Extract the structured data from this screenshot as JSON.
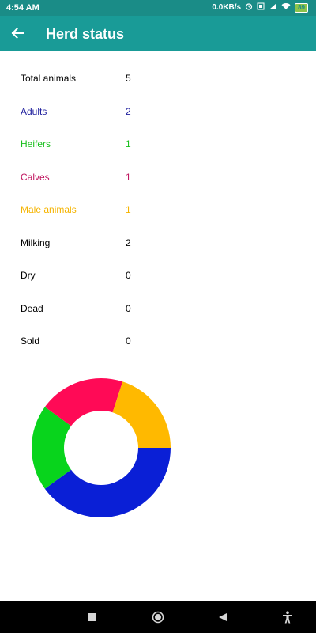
{
  "status_bar": {
    "time": "4:54 AM",
    "net_speed": "0.0KB/s",
    "battery": "89"
  },
  "app_bar": {
    "title": "Herd status",
    "back_icon": "arrow-left-icon"
  },
  "stats": [
    {
      "label": "Total animals",
      "value": "5",
      "color": "#000000"
    },
    {
      "label": "Adults",
      "value": "2",
      "color": "#1c1c9c"
    },
    {
      "label": "Heifers",
      "value": "1",
      "color": "#19c01d"
    },
    {
      "label": "Calves",
      "value": "1",
      "color": "#c0155f"
    },
    {
      "label": "Male animals",
      "value": "1",
      "color": "#f5b400"
    },
    {
      "label": "Milking",
      "value": "2",
      "color": "#000000"
    },
    {
      "label": "Dry",
      "value": "0",
      "color": "#000000"
    },
    {
      "label": "Dead",
      "value": "0",
      "color": "#000000"
    },
    {
      "label": "Sold",
      "value": "0",
      "color": "#000000"
    }
  ],
  "chart_data": {
    "type": "pie",
    "style": "donut",
    "categories": [
      "Adults",
      "Heifers",
      "Calves",
      "Male animals"
    ],
    "values": [
      2,
      1,
      1,
      1
    ],
    "colors": [
      "#0a1fd6",
      "#08d41c",
      "#ff0a56",
      "#ffb900"
    ],
    "title": ""
  },
  "nav_bar": {
    "icons": [
      "recents-square-icon",
      "home-circle-icon",
      "back-triangle-icon",
      "accessibility-icon"
    ]
  }
}
